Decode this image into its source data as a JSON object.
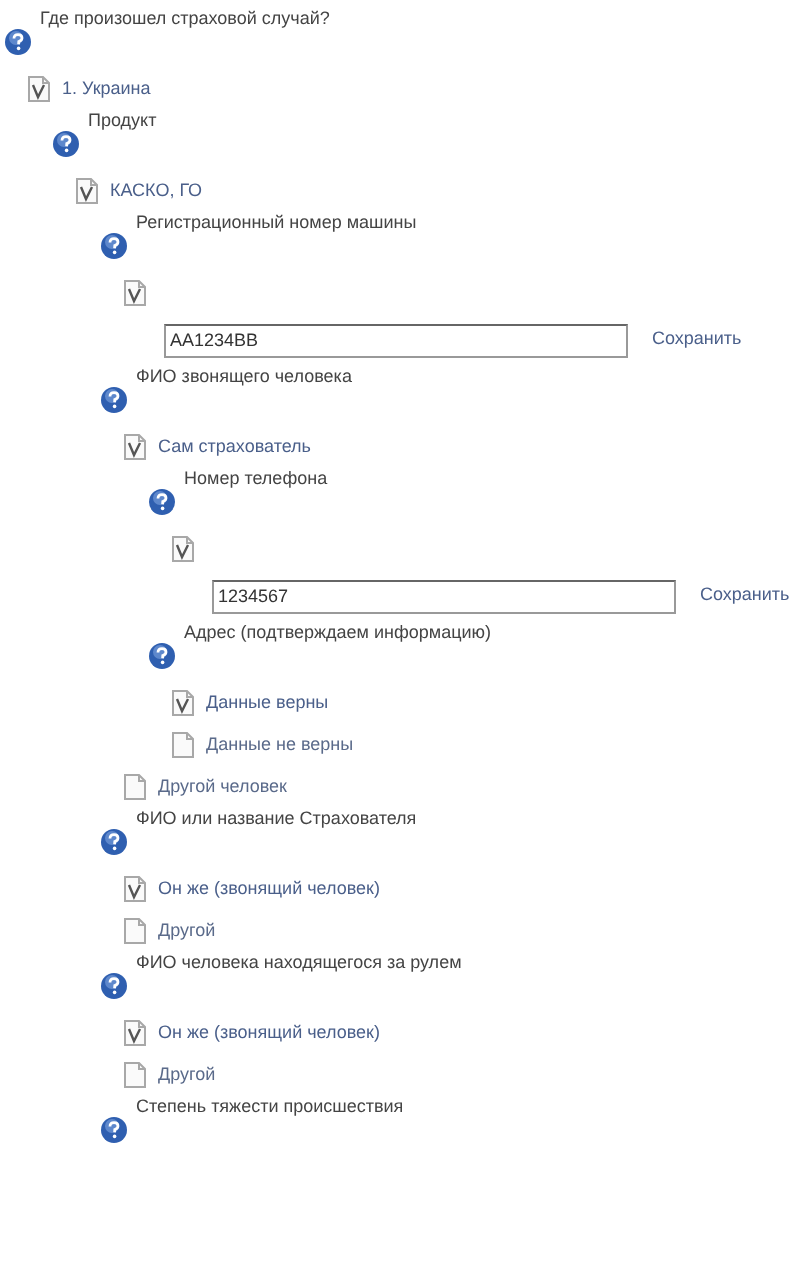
{
  "tree": [
    {
      "kind": "question",
      "text": "Где произошел страховой случай?",
      "children": [
        {
          "kind": "answer",
          "label": "1. Украина",
          "checked": true,
          "children": [
            {
              "kind": "question",
              "text": "Продукт",
              "children": [
                {
                  "kind": "answer",
                  "label": "КАСКО, ГО",
                  "checked": true,
                  "children": [
                    {
                      "kind": "question",
                      "text": "Регистрационный номер машины",
                      "children": [
                        {
                          "kind": "answer",
                          "checked": true,
                          "children": [
                            {
                              "kind": "input",
                              "value": "AA1234BB",
                              "button": "Сохранить"
                            }
                          ]
                        }
                      ]
                    },
                    {
                      "kind": "question",
                      "text": "ФИО звонящего человека",
                      "children": [
                        {
                          "kind": "answer",
                          "label": "Сам страхователь",
                          "checked": true,
                          "children": [
                            {
                              "kind": "question",
                              "text": "Номер телефона",
                              "children": [
                                {
                                  "kind": "answer",
                                  "checked": true,
                                  "children": [
                                    {
                                      "kind": "input",
                                      "value": "1234567",
                                      "button": "Сохранить"
                                    }
                                  ]
                                }
                              ]
                            },
                            {
                              "kind": "question",
                              "text": "Адрес (подтверждаем информацию)",
                              "children": [
                                {
                                  "kind": "answer",
                                  "label": "Данные верны",
                                  "checked": true
                                },
                                {
                                  "kind": "answer",
                                  "label": "Данные не верны",
                                  "checked": false
                                }
                              ]
                            }
                          ]
                        },
                        {
                          "kind": "answer",
                          "label": "Другой человек",
                          "checked": false
                        }
                      ]
                    },
                    {
                      "kind": "question",
                      "text": "ФИО или название Страхователя",
                      "children": [
                        {
                          "kind": "answer",
                          "label": "Он же (звонящий человек)",
                          "checked": true
                        },
                        {
                          "kind": "answer",
                          "label": "Другой",
                          "checked": false
                        }
                      ]
                    },
                    {
                      "kind": "question",
                      "text": "ФИО человека находящегося за рулем",
                      "children": [
                        {
                          "kind": "answer",
                          "label": "Он же (звонящий человек)",
                          "checked": true
                        },
                        {
                          "kind": "answer",
                          "label": "Другой",
                          "checked": false
                        }
                      ]
                    },
                    {
                      "kind": "question",
                      "text": "Степень тяжести происшествия"
                    }
                  ]
                }
              ]
            }
          ]
        }
      ]
    }
  ]
}
